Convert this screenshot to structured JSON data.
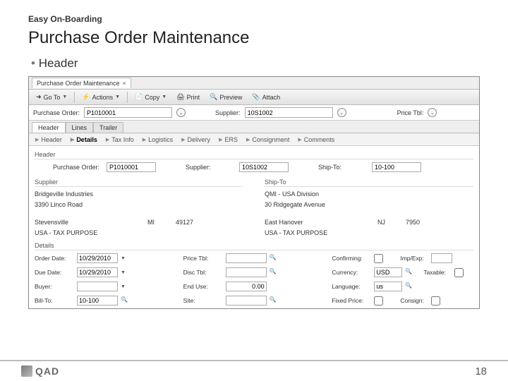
{
  "slide": {
    "eyebrow": "Easy On-Boarding",
    "title": "Purchase Order Maintenance",
    "bullet": "Header",
    "page": "18",
    "brand": "QAD"
  },
  "window": {
    "tab_title": "Purchase Order Maintenance",
    "close": "×"
  },
  "toolbar": {
    "goto": "Go To",
    "actions": "Actions",
    "copy": "Copy",
    "print": "Print",
    "preview": "Preview",
    "attach": "Attach"
  },
  "context": {
    "po_label": "Purchase Order:",
    "po_value": "P1010001",
    "supplier_label": "Supplier:",
    "supplier_value": "10S1002",
    "pricetbl_label": "Price Tbl:"
  },
  "tabs": {
    "header": "Header",
    "lines": "Lines",
    "trailer": "Trailer"
  },
  "nav": {
    "header": "Header",
    "details": "Details",
    "tax": "Tax Info",
    "logistics": "Logistics",
    "delivery": "Delivery",
    "ers": "ERS",
    "consign": "Consignment",
    "comments": "Comments",
    "section": "Header"
  },
  "form": {
    "po_label": "Purchase Order:",
    "po_value": "P1010001",
    "supplier_label": "Supplier:",
    "supplier_value": "10S1002",
    "shipto_label": "Ship-To:",
    "shipto_value": "10-100",
    "sect_supplier": "Supplier",
    "sect_shipto": "Ship-To",
    "sup_name": "Bridgeville Industries",
    "st_name": "QMI - USA Division",
    "sup_addr1": "3390 Linco Road",
    "st_addr1": "30 Ridgegate Avenue",
    "sup_city": "Stevensville",
    "sup_state": "MI",
    "sup_zip": "49127",
    "st_city": "East Hanover",
    "st_state": "NJ",
    "st_zip": "7950",
    "sup_ctry": "USA - TAX PURPOSE",
    "st_ctry": "USA - TAX PURPOSE",
    "sect_details": "Details"
  },
  "details": {
    "orderdate_l": "Order Date:",
    "orderdate_v": "10/29/2010",
    "pricetbl_l": "Price Tbl:",
    "confirming_l": "Confirming:",
    "impexp_l": "Imp/Exp:",
    "duedate_l": "Due Date:",
    "duedate_v": "10/29/2010",
    "disctbl_l": "Disc Tbl:",
    "currency_l": "Currency:",
    "currency_v": "USD",
    "taxable_l": "Taxable:",
    "buyer_l": "Buyer:",
    "enduse_l": "End Use:",
    "enduse_v": "0.00",
    "language_l": "Language:",
    "language_v": "us",
    "billto_l": "Bill-To:",
    "billto_v": "10-100",
    "site_l": "Site:",
    "fixedprice_l": "Fixed Price:",
    "consign_l": "Consign:"
  }
}
